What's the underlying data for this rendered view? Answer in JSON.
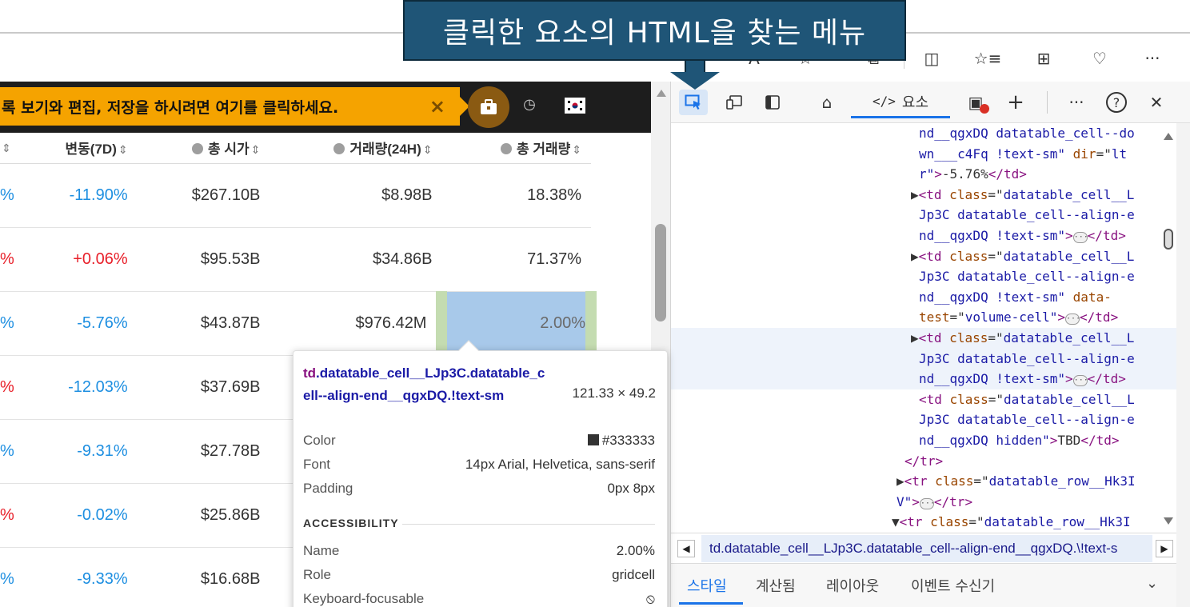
{
  "callout": {
    "text": "클릭한 요소의 HTML을 찾는 메뉴"
  },
  "browser_toolbar": {
    "icons": [
      "font-size-icon",
      "favorite-add-icon",
      "extension-icon",
      "split-screen-icon",
      "favorites-icon",
      "collections-icon",
      "browser-essentials-icon",
      "more-icon"
    ],
    "glyphs": {
      "font": "A",
      "star": "☆",
      "puzzle": "⧉",
      "split": "◫",
      "favlist": "☆≡",
      "collection": "⊞",
      "heart": "♡",
      "more": "···"
    }
  },
  "promo": {
    "text": "록 보기와 편집, 저장을 하시려면 여기를 클릭하세요.",
    "close": "×",
    "clock": "◷"
  },
  "table": {
    "headers": {
      "change7d": "변동(7D)",
      "market_cap": "총 시가",
      "volume": "거래량(24H)",
      "total_volume": "총 거래량"
    },
    "sort_glyph": "⇕",
    "rows": [
      {
        "pct": "%",
        "pct_dir": "down",
        "change7d": "-11.90%",
        "change_dir": "down",
        "market_cap": "$267.10B",
        "volume": "$8.98B",
        "total_volume": "18.38%"
      },
      {
        "pct": "%",
        "pct_dir": "up",
        "change7d": "+0.06%",
        "change_dir": "up",
        "market_cap": "$95.53B",
        "volume": "$34.86B",
        "total_volume": "71.37%"
      },
      {
        "pct": "%",
        "pct_dir": "down",
        "change7d": "-5.76%",
        "change_dir": "down",
        "market_cap": "$43.87B",
        "volume": "$976.42M",
        "total_volume": "2.00%"
      },
      {
        "pct": "%",
        "pct_dir": "up",
        "change7d": "-12.03%",
        "change_dir": "down",
        "market_cap": "$37.69B",
        "volume": "",
        "total_volume": ""
      },
      {
        "pct": "%",
        "pct_dir": "down",
        "change7d": "-9.31%",
        "change_dir": "down",
        "market_cap": "$27.78B",
        "volume": "",
        "total_volume": ""
      },
      {
        "pct": "%",
        "pct_dir": "up",
        "change7d": "-0.02%",
        "change_dir": "down",
        "market_cap": "$25.86B",
        "volume": "",
        "total_volume": ""
      },
      {
        "pct": "%",
        "pct_dir": "down",
        "change7d": "-9.33%",
        "change_dir": "down",
        "market_cap": "$16.68B",
        "volume": "",
        "total_volume": ""
      }
    ]
  },
  "tooltip": {
    "selector_tag": "td",
    "selector_rest": ".datatable_cell__LJp3C.datatable_cell--align-end__qgxDQ.!text-sm",
    "size": "121.33 × 49.2",
    "color_label": "Color",
    "color_value": "#333333",
    "font_label": "Font",
    "font_value": "14px Arial, Helvetica, sans-serif",
    "padding_label": "Padding",
    "padding_value": "0px 8px",
    "accessibility_heading": "ACCESSIBILITY",
    "name_label": "Name",
    "name_value": "2.00%",
    "role_label": "Role",
    "role_value": "gridcell",
    "keyboard_label": "Keyboard-focusable",
    "keyboard_value": "⦸"
  },
  "devtools": {
    "tabs": {
      "home_glyph": "⌂",
      "elements_code": "</>",
      "elements_label": "요소",
      "console_glyph": "▣",
      "add_glyph": "+",
      "more_glyph": "···",
      "help_glyph": "?",
      "close_glyph": "✕"
    },
    "tree_lines": [
      {
        "parts": [
          [
            "s",
            "nd__qgxDQ datatable_cell--do"
          ]
        ]
      },
      {
        "parts": [
          [
            "s",
            "wn___c4Fq !text-sm\""
          ],
          [
            "a",
            " dir"
          ],
          [
            "",
            "=\""
          ],
          [
            "s",
            "lt"
          ]
        ]
      },
      {
        "parts": [
          [
            "s",
            "r\""
          ],
          [
            "t",
            ">"
          ],
          [
            "",
            "-5.76%"
          ],
          [
            "t",
            "</td>"
          ]
        ]
      },
      {
        "parts": [
          [
            "tri",
            "▶"
          ],
          [
            "t",
            "<td"
          ],
          [
            "a",
            " class"
          ],
          [
            "",
            "=\""
          ],
          [
            "s",
            "datatable_cell__L"
          ]
        ]
      },
      {
        "parts": [
          [
            "s",
            "Jp3C datatable_cell--align-e"
          ]
        ]
      },
      {
        "parts": [
          [
            "s",
            "nd__qgxDQ !text-sm\""
          ],
          [
            "t",
            ">"
          ],
          [
            "ell",
            "···"
          ],
          [
            "t",
            "</td>"
          ]
        ]
      },
      {
        "parts": [
          [
            "tri",
            "▶"
          ],
          [
            "t",
            "<td"
          ],
          [
            "a",
            " class"
          ],
          [
            "",
            "=\""
          ],
          [
            "s",
            "datatable_cell__L"
          ]
        ]
      },
      {
        "parts": [
          [
            "s",
            "Jp3C datatable_cell--align-e"
          ]
        ]
      },
      {
        "parts": [
          [
            "s",
            "nd__qgxDQ !text-sm\""
          ],
          [
            "a",
            " data-"
          ]
        ]
      },
      {
        "parts": [
          [
            "a",
            "test"
          ],
          [
            "",
            "=\""
          ],
          [
            "s",
            "volume-cell\""
          ],
          [
            "t",
            ">"
          ],
          [
            "ell",
            "···"
          ],
          [
            "t",
            "</td>"
          ]
        ]
      },
      {
        "parts": [
          [
            "tri",
            "▶"
          ],
          [
            "t",
            "<td"
          ],
          [
            "a",
            " class"
          ],
          [
            "",
            "=\""
          ],
          [
            "s",
            "datatable_cell__L"
          ]
        ]
      },
      {
        "parts": [
          [
            "s",
            "Jp3C datatable_cell--align-e"
          ]
        ]
      },
      {
        "parts": [
          [
            "s",
            "nd__qgxDQ !text-sm\""
          ],
          [
            "t",
            ">"
          ],
          [
            "ell",
            "···"
          ],
          [
            "t",
            "</td>"
          ]
        ]
      },
      {
        "parts": [
          [
            "t",
            "<td"
          ],
          [
            "a",
            " class"
          ],
          [
            "",
            "=\""
          ],
          [
            "s",
            "datatable_cell__L"
          ]
        ]
      },
      {
        "parts": [
          [
            "s",
            "Jp3C datatable_cell--align-e"
          ]
        ]
      },
      {
        "parts": [
          [
            "s",
            "nd__qgxDQ hidden\""
          ],
          [
            "t",
            ">"
          ],
          [
            "",
            "TBD"
          ],
          [
            "t",
            "</td>"
          ]
        ]
      },
      {
        "parts": [
          [
            "t",
            "</tr>"
          ]
        ]
      },
      {
        "parts": [
          [
            "tri",
            "▶"
          ],
          [
            "t",
            "<tr"
          ],
          [
            "a",
            " class"
          ],
          [
            "",
            "=\""
          ],
          [
            "s",
            "datatable_row__Hk3I"
          ]
        ]
      },
      {
        "parts": [
          [
            "s",
            "V\""
          ],
          [
            "t",
            ">"
          ],
          [
            "ell",
            "···"
          ],
          [
            "t",
            "</tr>"
          ]
        ]
      },
      {
        "parts": [
          [
            "tri",
            "▼"
          ],
          [
            "t",
            "<tr"
          ],
          [
            "a",
            " class"
          ],
          [
            "",
            "=\""
          ],
          [
            "s",
            "datatable_row__Hk3I"
          ]
        ]
      }
    ],
    "breadcrumb": "td.datatable_cell__LJp3C.datatable_cell--align-end__qgxDQ.\\!text-s",
    "subtabs": [
      "스타일",
      "계산됨",
      "레이아웃",
      "이벤트 수신기"
    ],
    "subtab_more": "⌄"
  }
}
